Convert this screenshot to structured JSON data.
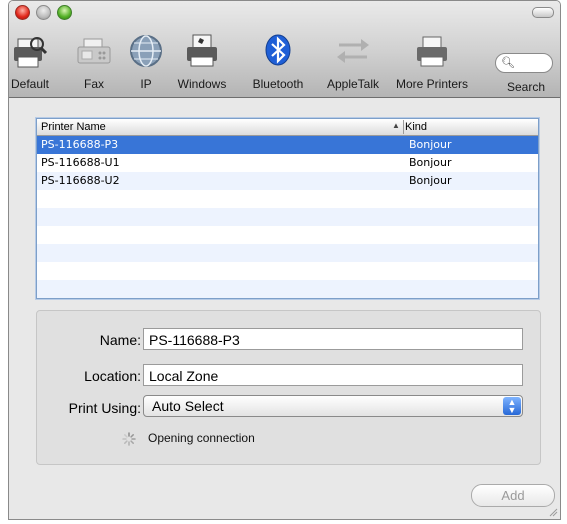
{
  "toolbar": {
    "items": [
      {
        "label": "Default",
        "icon": "default-printer-icon"
      },
      {
        "label": "Fax",
        "icon": "fax-icon"
      },
      {
        "label": "IP",
        "icon": "ip-globe-icon"
      },
      {
        "label": "Windows",
        "icon": "windows-printer-icon"
      },
      {
        "label": "Bluetooth",
        "icon": "bluetooth-icon"
      },
      {
        "label": "AppleTalk",
        "icon": "appletalk-arrows-icon"
      },
      {
        "label": "More Printers",
        "icon": "more-printers-icon"
      }
    ],
    "search_label": "Search",
    "search_placeholder": ""
  },
  "list": {
    "columns": [
      "Printer Name",
      "Kind"
    ],
    "rows": [
      {
        "name": "PS-116688-P3",
        "kind": "Bonjour",
        "selected": true
      },
      {
        "name": "PS-116688-U1",
        "kind": "Bonjour",
        "selected": false
      },
      {
        "name": "PS-116688-U2",
        "kind": "Bonjour",
        "selected": false
      }
    ]
  },
  "form": {
    "name_label": "Name:",
    "name_value": "PS-116688-P3",
    "location_label": "Location:",
    "location_value": "Local Zone",
    "print_using_label": "Print Using:",
    "print_using_value": "Auto Select",
    "status_text": "Opening connection"
  },
  "buttons": {
    "add_label": "Add"
  },
  "colors": {
    "selection": "#3875d7",
    "bluetooth": "#1f5fd6"
  }
}
